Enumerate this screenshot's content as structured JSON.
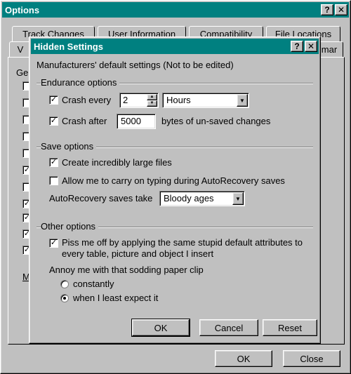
{
  "options_window": {
    "title": "Options",
    "help_btn": "?",
    "close_btn": "✕",
    "tabs_row1": [
      "Track Changes",
      "User Information",
      "Compatibility",
      "File Locations"
    ],
    "tabs_row2_first": "V",
    "tabs_row2_last": "mar",
    "general_label": "Gen",
    "side_label": "M",
    "ok_label": "OK",
    "close_label": "Close"
  },
  "dialog": {
    "title": "Hidden Settings",
    "help_btn": "?",
    "close_btn": "✕",
    "description": "Manufacturers' default settings  (Not to be edited)",
    "endurance": {
      "header": "Endurance options",
      "crash_every_label": "Crash every",
      "crash_every_value": "2",
      "crash_every_unit": "Hours",
      "crash_after_label": "Crash after",
      "crash_after_value": "5000",
      "crash_after_suffix": "bytes of un-saved changes"
    },
    "save": {
      "header": "Save options",
      "large_files_label": "Create incredibly large files",
      "allow_typing_label": "Allow me to carry on typing during AutoRecovery saves",
      "autorecovery_label": "AutoRecovery saves take",
      "autorecovery_value": "Bloody ages"
    },
    "other": {
      "header": "Other options",
      "piss_line1": "Piss me off by applying the same stupid default attributes to",
      "piss_line2": "every table, picture and object I insert",
      "annoy_label": "Annoy me with that sodding paper clip",
      "radio_constantly": "constantly",
      "radio_unexpected": "when I least expect it"
    },
    "buttons": {
      "ok": "OK",
      "cancel": "Cancel",
      "reset": "Reset"
    }
  }
}
